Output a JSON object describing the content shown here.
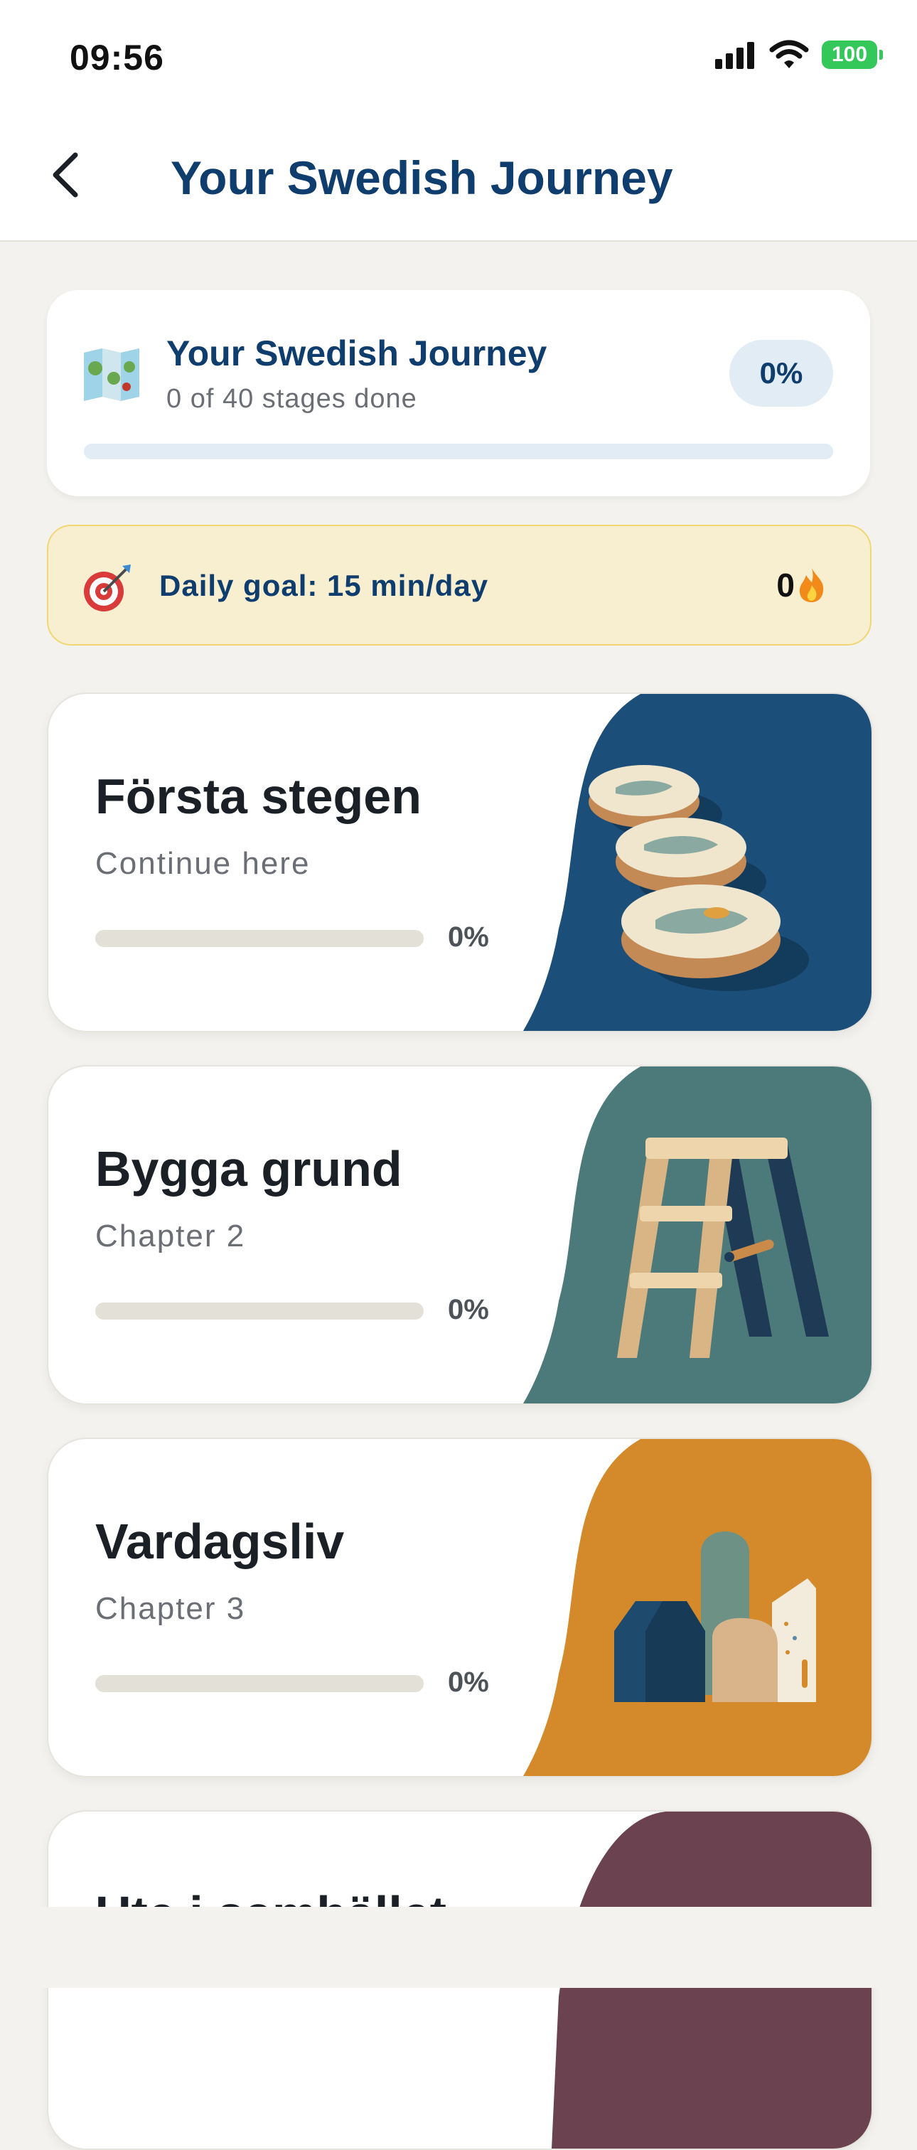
{
  "status_bar": {
    "time": "09:56",
    "battery": "100"
  },
  "header": {
    "title": "Your Swedish Journey"
  },
  "journey": {
    "title": "Your Swedish Journey",
    "subtitle": "0 of 40 stages done",
    "percent_label": "0%",
    "progress": 0
  },
  "daily_goal": {
    "label": "Daily goal: 15 min/day",
    "streak": "0"
  },
  "chapters": [
    {
      "title": "Första stegen",
      "subtitle": "Continue here",
      "percent_label": "0%",
      "progress": 0,
      "color": "#1b4f79"
    },
    {
      "title": "Bygga grund",
      "subtitle": "Chapter 2",
      "percent_label": "0%",
      "progress": 0,
      "color": "#4c7a7a"
    },
    {
      "title": "Vardagsliv",
      "subtitle": "Chapter 3",
      "percent_label": "0%",
      "progress": 0,
      "color": "#d48a2a"
    },
    {
      "title": "Ute i samhället",
      "color": "#6b4350"
    }
  ],
  "colors": {
    "brand": "#0f3d6e",
    "background": "#f3f2ee",
    "goal_bg": "#f7efd0"
  },
  "icons": [
    "back-chevron-icon",
    "map-icon",
    "target-icon",
    "fire-icon",
    "signal-icon",
    "wifi-icon",
    "battery-icon"
  ]
}
